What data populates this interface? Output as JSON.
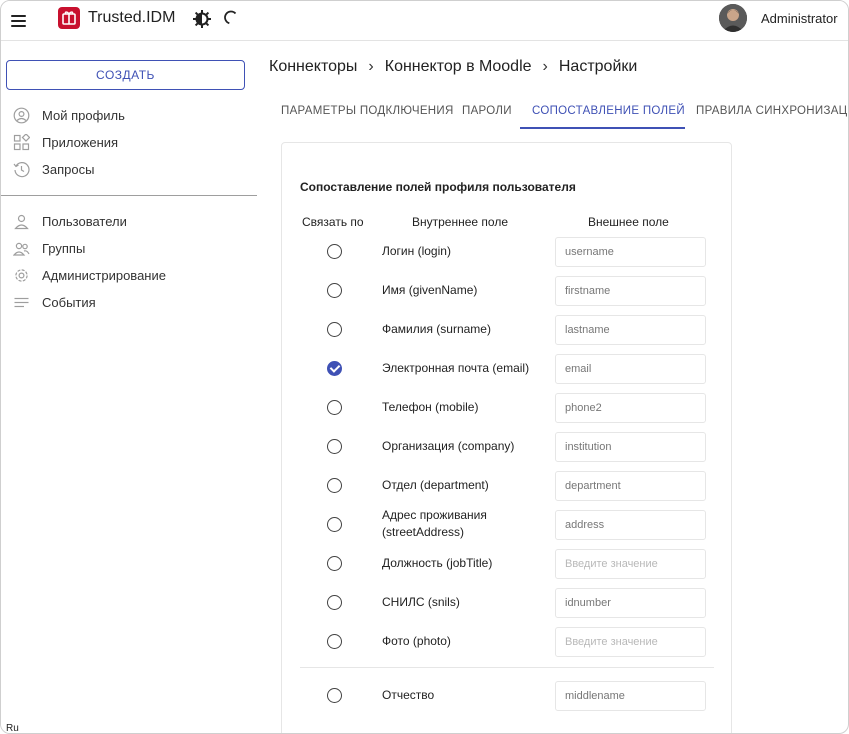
{
  "header": {
    "app_title": "Trusted.IDM",
    "user_name": "Administrator",
    "icons": [
      "menu-icon",
      "logo-icon",
      "theme-toggle-icon",
      "refresh-icon"
    ]
  },
  "sidebar": {
    "create_label": "СОЗДАТЬ",
    "items": [
      {
        "label": "Мой профиль",
        "icon": "user-circle-icon"
      },
      {
        "label": "Приложения",
        "icon": "apps-grid-icon"
      },
      {
        "label": "Запросы",
        "icon": "history-icon"
      },
      {
        "label": "Пользователи",
        "icon": "user-icon"
      },
      {
        "label": "Группы",
        "icon": "group-icon"
      },
      {
        "label": "Администрирование",
        "icon": "gear-icon"
      },
      {
        "label": "События",
        "icon": "list-icon"
      }
    ]
  },
  "breadcrumb": [
    "Коннекторы",
    "Коннектор в Moodle",
    "Настройки"
  ],
  "tabs": {
    "items": [
      "ПАРАМЕТРЫ ПОДКЛЮЧЕНИЯ",
      "ПАРОЛИ",
      "СОПОСТАВЛЕНИЕ ПОЛЕЙ",
      "ПРАВИЛА СИНХРОНИЗАЦИИ"
    ],
    "active_index": 2
  },
  "mapping": {
    "title": "Сопоставление полей профиля пользователя",
    "col_link": "Связать по",
    "col_internal": "Внутреннее поле",
    "col_external": "Внешнее поле",
    "rows": [
      {
        "label": "Логин (login)",
        "value": "username",
        "placeholder": "",
        "checked": false
      },
      {
        "label": "Имя (givenName)",
        "value": "firstname",
        "placeholder": "",
        "checked": false
      },
      {
        "label": "Фамилия (surname)",
        "value": "lastname",
        "placeholder": "",
        "checked": false
      },
      {
        "label": "Электронная почта (email)",
        "value": "email",
        "placeholder": "",
        "checked": true
      },
      {
        "label": "Телефон (mobile)",
        "value": "phone2",
        "placeholder": "",
        "checked": false
      },
      {
        "label": "Организация (company)",
        "value": "institution",
        "placeholder": "",
        "checked": false
      },
      {
        "label": "Отдел (department)",
        "value": "department",
        "placeholder": "",
        "checked": false
      },
      {
        "label_line1": "Адрес проживания",
        "label_line2": "(streetAddress)",
        "value": "address",
        "placeholder": "",
        "checked": false
      },
      {
        "label": "Должность (jobTitle)",
        "value": "",
        "placeholder": "Введите значение",
        "checked": false
      },
      {
        "label": "СНИЛС (snils)",
        "value": "idnumber",
        "placeholder": "",
        "checked": false
      },
      {
        "label": "Фото (photo)",
        "value": "",
        "placeholder": "Введите значение",
        "checked": false
      },
      {
        "label": "Отчество",
        "value": "middlename",
        "placeholder": "",
        "checked": false
      }
    ]
  },
  "footer": {
    "language": "Ru"
  },
  "colors": {
    "accent": "#3f51b5",
    "logo": "#c8102e"
  }
}
